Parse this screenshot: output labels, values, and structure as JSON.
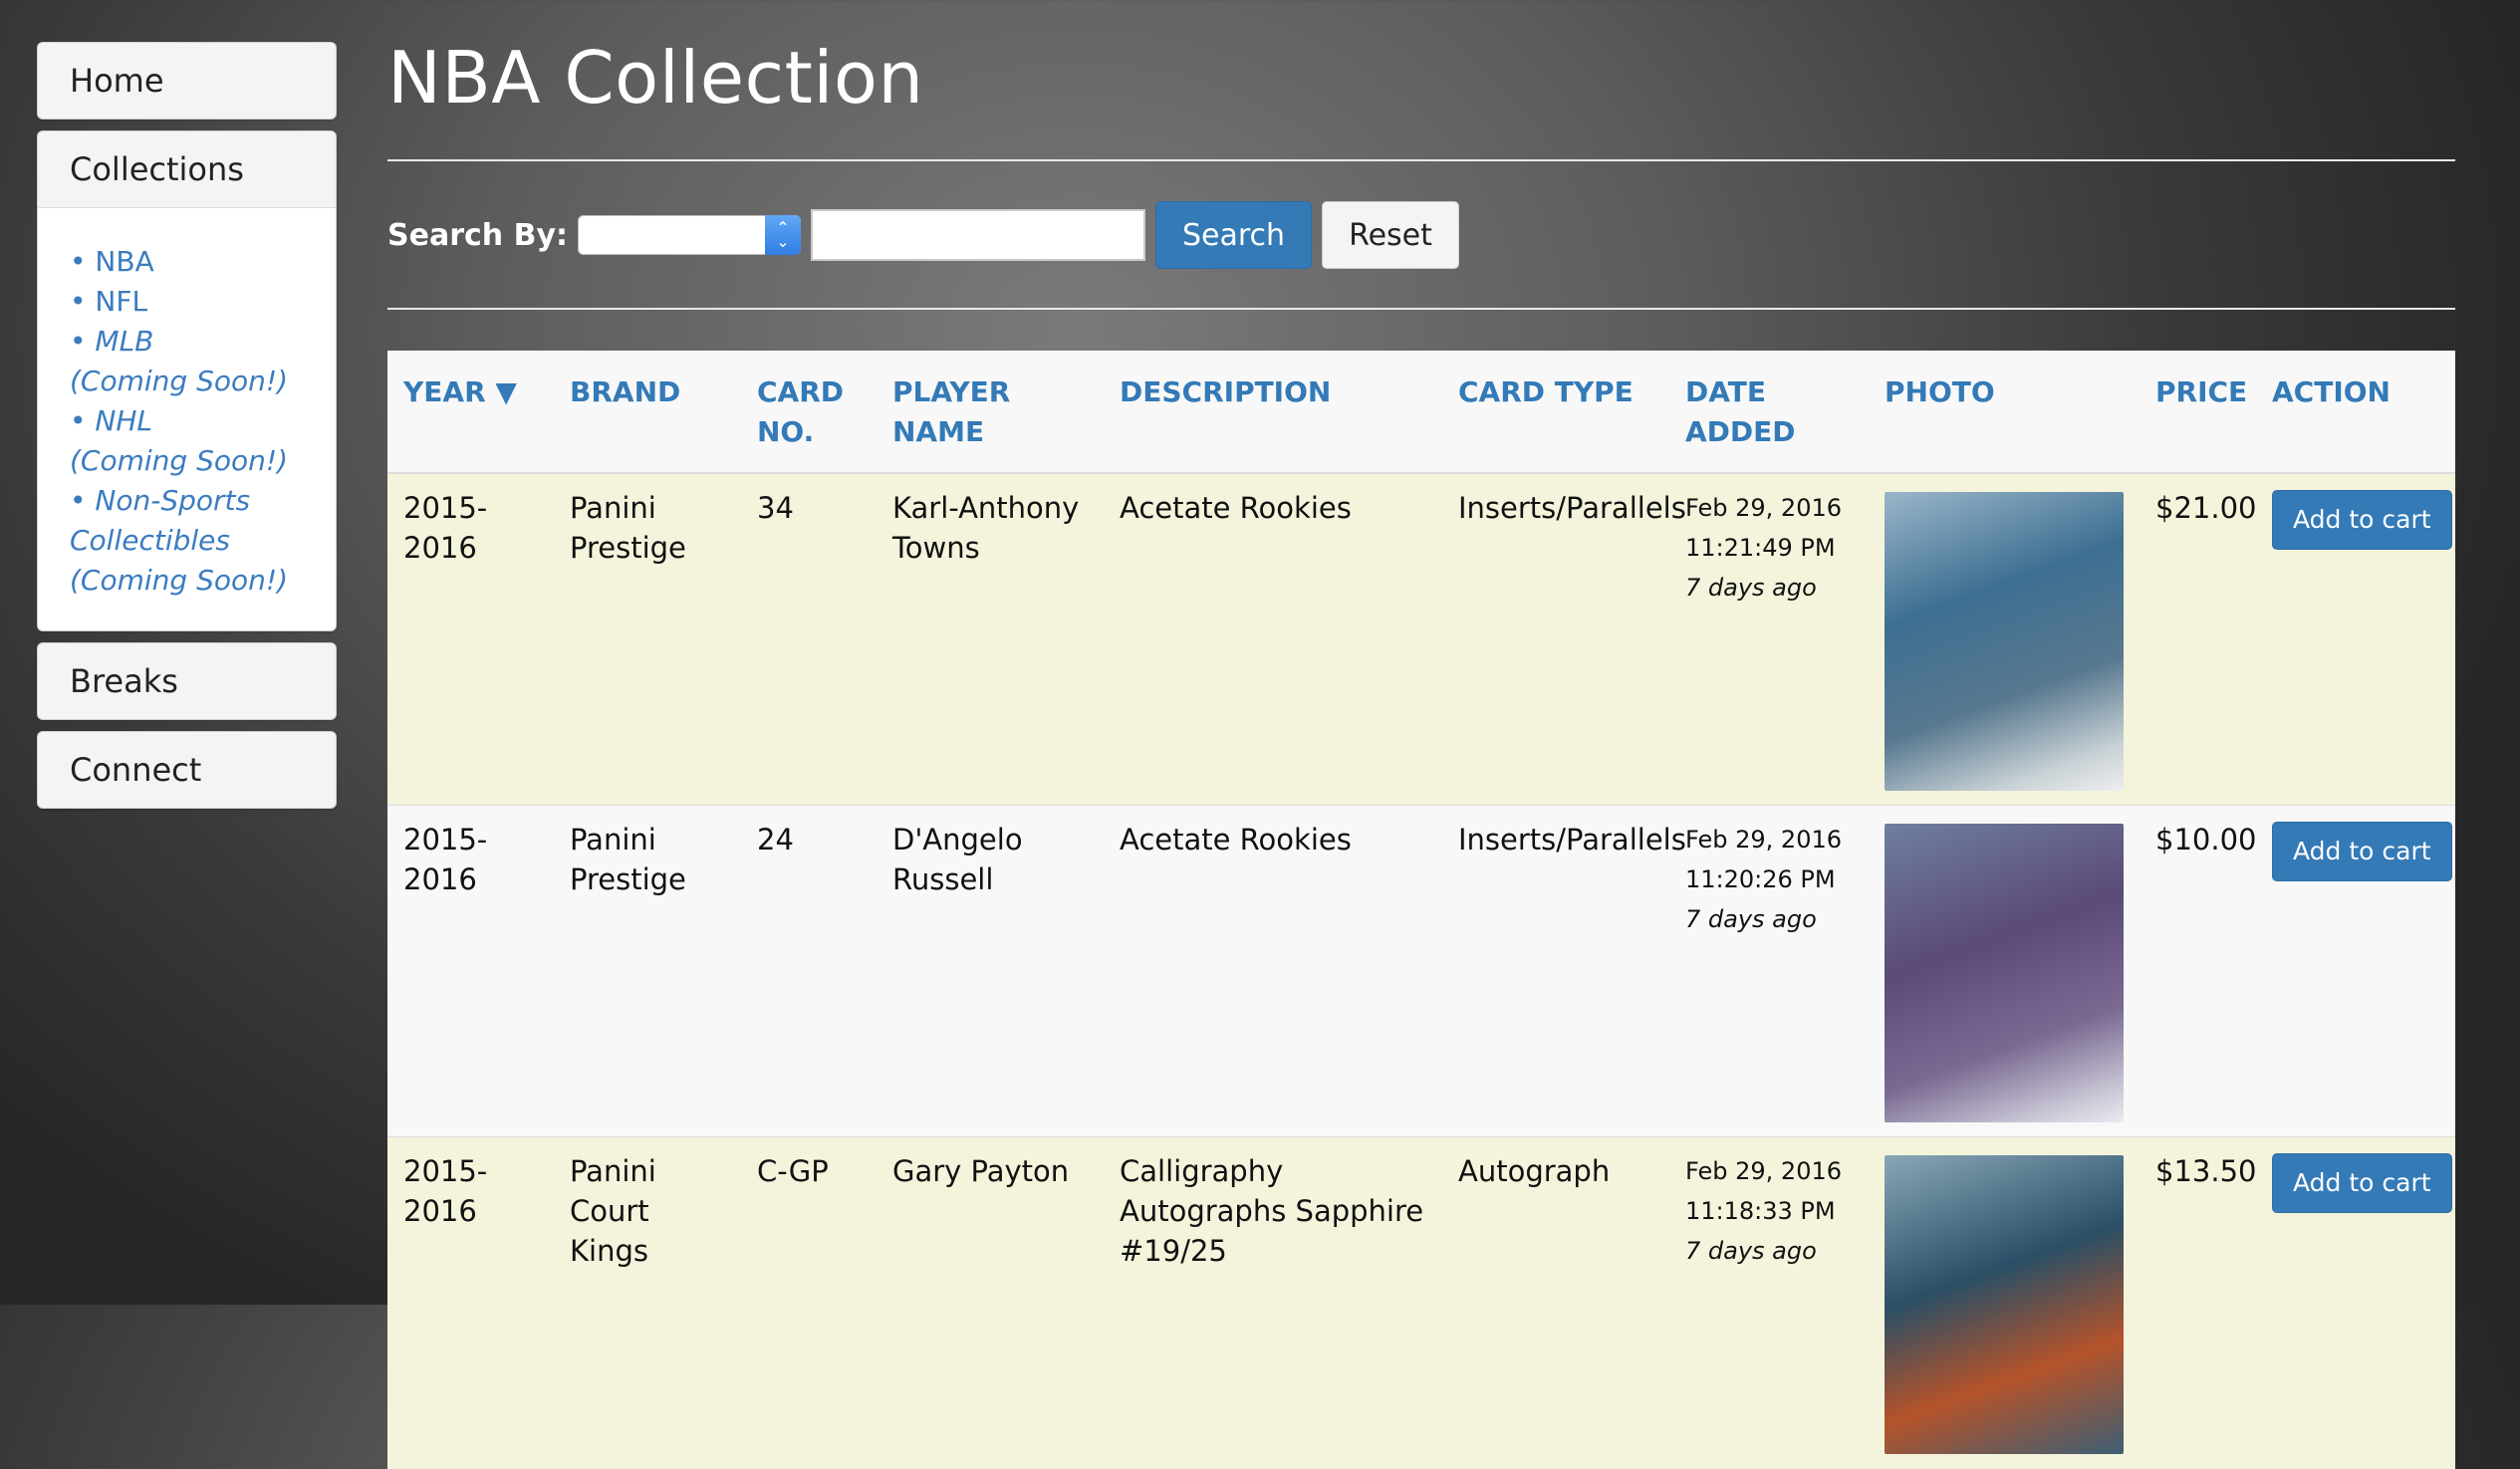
{
  "sidebar": {
    "home": "Home",
    "collections": {
      "title": "Collections",
      "links": [
        {
          "label": "• NBA",
          "soon": ""
        },
        {
          "label": "• NFL",
          "soon": ""
        },
        {
          "label": "• MLB",
          "soon": "(Coming Soon!)"
        },
        {
          "label": "• NHL",
          "soon": "(Coming Soon!)"
        },
        {
          "label": "• Non-Sports Collectibles",
          "soon": "(Coming Soon!)"
        }
      ]
    },
    "breaks": "Breaks",
    "connect": "Connect"
  },
  "page_title": "NBA Collection",
  "search": {
    "label": "Search By:",
    "select_value": "",
    "input_value": "",
    "search_button": "Search",
    "reset_button": "Reset"
  },
  "table": {
    "headers": [
      "YEAR ▼",
      "BRAND",
      "CARD NO.",
      "PLAYER NAME",
      "DESCRIPTION",
      "CARD TYPE",
      "DATE ADDED",
      "PHOTO",
      "PRICE",
      "ACTION"
    ],
    "rows": [
      {
        "year": "2015-2016",
        "brand": "Panini Prestige",
        "card_no": "34",
        "player": "Karl-Anthony Towns",
        "description": "Acetate Rookies",
        "card_type": "Inserts/Parallels",
        "date": "Feb 29, 2016",
        "time": "11:21:49 PM",
        "ago": "7 days ago",
        "price": "$21.00",
        "action": "Add to cart",
        "photo_color": "#3d6f92"
      },
      {
        "year": "2015-2016",
        "brand": "Panini Prestige",
        "card_no": "24",
        "player": "D'Angelo Russell",
        "description": "Acetate Rookies",
        "card_type": "Inserts/Parallels",
        "date": "Feb 29, 2016",
        "time": "11:20:26 PM",
        "ago": "7 days ago",
        "price": "$10.00",
        "action": "Add to cart",
        "photo_color": "#5b4a78"
      },
      {
        "year": "2015-2016",
        "brand": "Panini Court Kings",
        "card_no": "C-GP",
        "player": "Gary Payton",
        "description": "Calligraphy Autographs Sapphire #19/25",
        "card_type": "Autograph",
        "date": "Feb 29, 2016",
        "time": "11:18:33 PM",
        "ago": "7 days ago",
        "price": "$13.50",
        "action": "Add to cart",
        "photo_color": "#2a4f66"
      }
    ]
  },
  "colors": {
    "link": "#337ab7",
    "odd_row": "#f4f4dc",
    "even_row": "#f8f8f8",
    "header_text": "#337ab7"
  }
}
